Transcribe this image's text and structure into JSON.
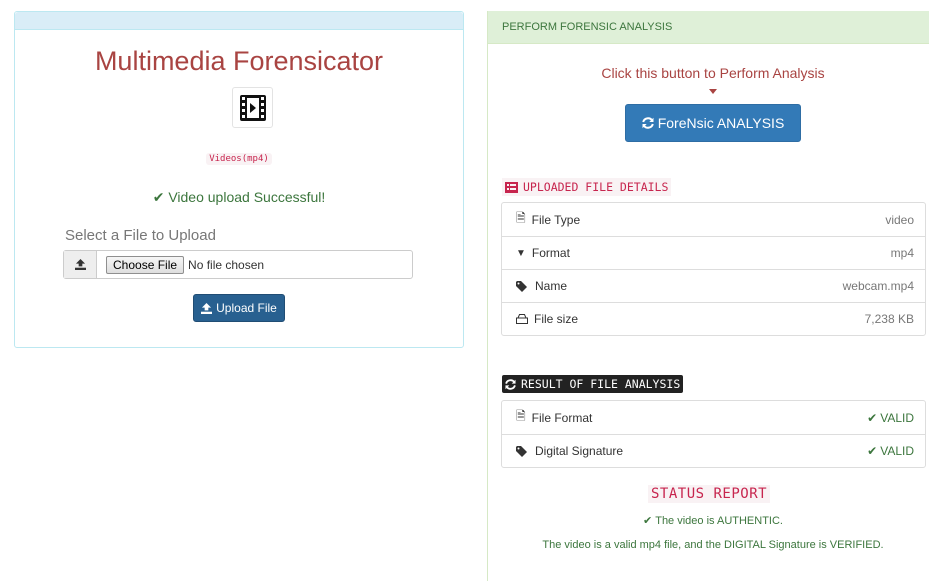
{
  "app": {
    "title": "Multimedia Forensicator",
    "file_type_code": "Videos(mp4)",
    "upload_status": "Video upload Successful!"
  },
  "upload": {
    "select_label": "Select a File to Upload",
    "choose_button": "Choose File",
    "no_file_text": "No file chosen",
    "upload_button": "Upload File"
  },
  "analysis": {
    "panel_title": "PERFORM FORENSIC ANALYSIS",
    "prompt": "Click this button to Perform Analysis",
    "button": "ForeNsic ANALYSIS"
  },
  "details": {
    "title": "UPLOADED FILE DETAILS",
    "rows": [
      {
        "label": "File Type",
        "value": "video",
        "icon": "file-icon"
      },
      {
        "label": "Format",
        "value": "mp4",
        "icon": "filter-icon"
      },
      {
        "label": "Name",
        "value": "webcam.mp4",
        "icon": "tags-icon"
      },
      {
        "label": "File size",
        "value": "7,238 KB",
        "icon": "hdd-icon"
      }
    ]
  },
  "results": {
    "title": "RESULT OF FILE ANALYSIS",
    "rows": [
      {
        "label": "File Format",
        "value": "VALID",
        "icon": "file-icon"
      },
      {
        "label": "Digital Signature",
        "value": "VALID",
        "icon": "tags-icon"
      }
    ]
  },
  "status": {
    "title": "STATUS REPORT",
    "line": "The video is AUTHENTIC.",
    "detail": "The video is a valid mp4 file, and the DIGITAL Signature is VERIFIED."
  },
  "colors": {
    "danger": "#a94442",
    "success": "#3c763d",
    "primary": "#337ab7",
    "code": "#c7254e"
  }
}
